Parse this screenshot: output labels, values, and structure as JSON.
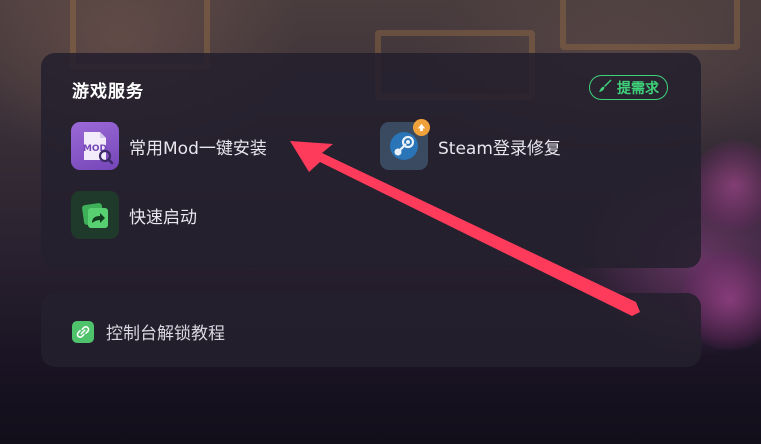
{
  "services": {
    "title": "游戏服务",
    "request_label": "提需求",
    "items": [
      {
        "label": "常用Mod一键安装",
        "icon": "mod-package-icon"
      },
      {
        "label": "Steam登录修复",
        "icon": "steam-icon"
      },
      {
        "label": "快速启动",
        "icon": "quick-launch-icon"
      }
    ]
  },
  "tutorial": {
    "label": "控制台解锁教程",
    "icon": "link-icon"
  },
  "colors": {
    "accent_green": "#3ed27a",
    "annotation_arrow": "#ff3b5c",
    "card_bg": "#24202e"
  }
}
